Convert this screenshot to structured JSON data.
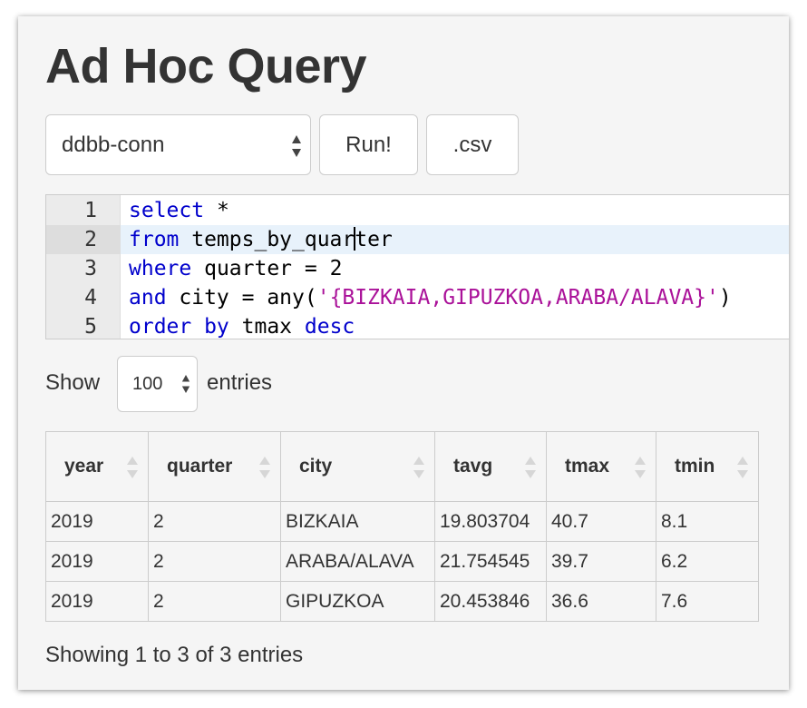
{
  "header": {
    "title": "Ad Hoc Query"
  },
  "toolbar": {
    "connection_selected": "ddbb-conn",
    "run_label": "Run!",
    "csv_label": ".csv"
  },
  "editor": {
    "lines": [
      {
        "number": "1",
        "tokens": [
          {
            "t": "select",
            "c": "kw"
          },
          {
            "t": " *",
            "c": ""
          }
        ]
      },
      {
        "number": "2",
        "tokens": [
          {
            "t": "from",
            "c": "kw"
          },
          {
            "t": " temps_by_quar",
            "c": ""
          },
          {
            "t": "",
            "c": "cursor"
          },
          {
            "t": "ter",
            "c": ""
          }
        ]
      },
      {
        "number": "3",
        "tokens": [
          {
            "t": "where",
            "c": "kw"
          },
          {
            "t": " quarter = 2",
            "c": ""
          }
        ]
      },
      {
        "number": "4",
        "tokens": [
          {
            "t": "and",
            "c": "kw"
          },
          {
            "t": " city = any(",
            "c": ""
          },
          {
            "t": "'{BIZKAIA,GIPUZKOA,ARABA/ALAVA}'",
            "c": "str"
          },
          {
            "t": ")",
            "c": ""
          }
        ]
      },
      {
        "number": "5",
        "tokens": [
          {
            "t": "order by",
            "c": "kw"
          },
          {
            "t": " tmax ",
            "c": ""
          },
          {
            "t": "desc",
            "c": "kw"
          }
        ]
      }
    ],
    "active_line": 2
  },
  "length": {
    "label_left": "Show",
    "selected": "100",
    "label_right": "entries"
  },
  "table": {
    "columns": [
      "year",
      "quarter",
      "city",
      "tavg",
      "tmax",
      "tmin"
    ],
    "rows": [
      [
        "2019",
        "2",
        "BIZKAIA",
        "19.803704",
        "40.7",
        "8.1"
      ],
      [
        "2019",
        "2",
        "ARABA/ALAVA",
        "21.754545",
        "39.7",
        "6.2"
      ],
      [
        "2019",
        "2",
        "GIPUZKOA",
        "20.453846",
        "36.6",
        "7.6"
      ]
    ]
  },
  "info": {
    "text": "Showing 1 to 3 of 3 entries"
  },
  "colors": {
    "keyword": "#0000cc",
    "string": "#aa1199",
    "panel_bg": "#f5f5f5",
    "active_line_bg": "#e8f2fb"
  }
}
